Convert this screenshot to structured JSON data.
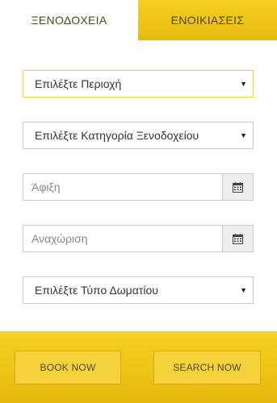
{
  "tabs": {
    "hotels_label": "ΞΕΝΟΔΟΧΕΙΑ",
    "rentals_label": "ΕΝΟΙΚΙΑΣΕΙΣ"
  },
  "form": {
    "region": {
      "value": "Επιλέξτε Περιοχή"
    },
    "hotel_category": {
      "value": "Επιλέξτε Κατηγορία Ξενοδοχείου"
    },
    "arrival": {
      "placeholder": "Άφιξη"
    },
    "departure": {
      "placeholder": "Αναχώριση"
    },
    "room_type": {
      "value": "Επιλέξτε Τύπο Δωματίου"
    }
  },
  "icons": {
    "caret": "caret-down-icon",
    "calendar": "calendar-icon"
  },
  "footer": {
    "book_label": "BOOK NOW",
    "search_label": "SEARCH NOW"
  },
  "colors": {
    "accent": "#f2c617",
    "button": "#f6d33c",
    "focus_border": "#f3d54a"
  }
}
